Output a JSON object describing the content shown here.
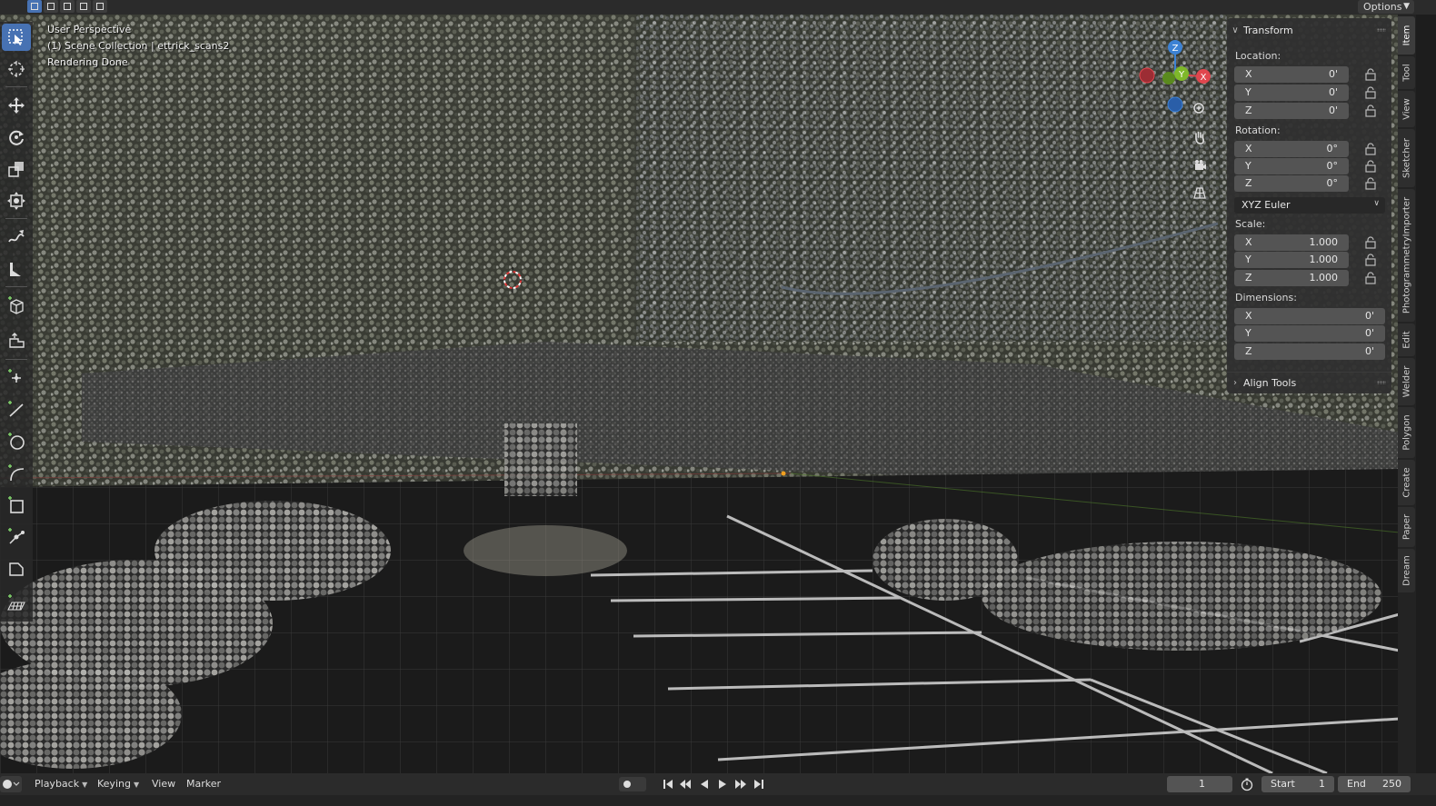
{
  "header": {
    "select_modes": [
      "select-box-icon",
      "select-extend-icon",
      "select-subtract-icon",
      "select-intersect-icon",
      "select-invert-icon"
    ],
    "options_label": "Options"
  },
  "viewport": {
    "perspective_label": "User Perspective",
    "collection_label": "(1) Scene Collection | ettrick_scans2",
    "status_label": "Rendering Done"
  },
  "toolbar": {
    "tools": [
      "select-box-icon",
      "cursor-icon",
      "move-icon",
      "rotate-icon",
      "scale-icon",
      "transform-icon",
      "annotate-icon",
      "measure-icon",
      "add-cube-icon",
      "extrude-icon",
      "add-point-icon",
      "add-line-icon",
      "add-circle-icon",
      "add-arc-icon",
      "add-rectangle-icon",
      "add-vertex-icon",
      "add-face-icon",
      "add-grid-icon"
    ]
  },
  "gizmo": {
    "axes": {
      "x": "X",
      "y": "Y",
      "z": "Z"
    },
    "colors": {
      "x": "#e0464e",
      "y": "#7fb82a",
      "z": "#3d82d4",
      "x_neg": "#9c2d34",
      "y_neg": "#5a8a1e",
      "z_neg": "#2a5ea8"
    },
    "buttons": [
      "zoom-icon",
      "pan-hand-icon",
      "camera-icon",
      "grid-ortho-icon"
    ]
  },
  "npanel": {
    "transform_title": "Transform",
    "location_label": "Location:",
    "location": [
      {
        "axis": "X",
        "value": "0'"
      },
      {
        "axis": "Y",
        "value": "0'"
      },
      {
        "axis": "Z",
        "value": "0'"
      }
    ],
    "rotation_label": "Rotation:",
    "rotation": [
      {
        "axis": "X",
        "value": "0°"
      },
      {
        "axis": "Y",
        "value": "0°"
      },
      {
        "axis": "Z",
        "value": "0°"
      }
    ],
    "rotation_mode": "XYZ Euler",
    "scale_label": "Scale:",
    "scale": [
      {
        "axis": "X",
        "value": "1.000"
      },
      {
        "axis": "Y",
        "value": "1.000"
      },
      {
        "axis": "Z",
        "value": "1.000"
      }
    ],
    "dimensions_label": "Dimensions:",
    "dimensions": [
      {
        "axis": "X",
        "value": "0'"
      },
      {
        "axis": "Y",
        "value": "0'"
      },
      {
        "axis": "Z",
        "value": "0'"
      }
    ],
    "align_tools_title": "Align Tools"
  },
  "vtabs": [
    "Item",
    "Tool",
    "View",
    "Sketcher",
    "PhotogrammetryImporter",
    "Edit",
    "Welder",
    "Polygon",
    "Create",
    "Paper",
    "Dream"
  ],
  "timeline": {
    "menus": {
      "playback": "Playback",
      "keying": "Keying",
      "view": "View",
      "marker": "Marker"
    },
    "current_frame": "1",
    "start_label": "Start",
    "start_value": "1",
    "end_label": "End",
    "end_value": "250"
  },
  "colors": {
    "accent": "#4772b3",
    "field_bg": "#545454",
    "panel_bg": "#303030"
  }
}
